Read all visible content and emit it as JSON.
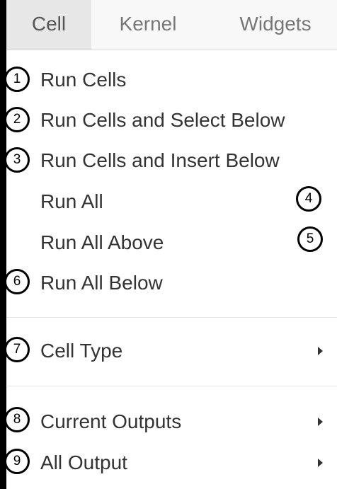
{
  "menubar": {
    "tabs": [
      {
        "label": "Cell",
        "active": true
      },
      {
        "label": "Kernel",
        "active": false
      },
      {
        "label": "Widgets",
        "active": false
      }
    ]
  },
  "cell_menu": {
    "items": [
      {
        "label": "Run Cells",
        "callout": "1"
      },
      {
        "label": "Run Cells and Select Below",
        "callout": "2"
      },
      {
        "label": "Run Cells and Insert Below",
        "callout": "3"
      },
      {
        "label": "Run All",
        "callout": "4"
      },
      {
        "label": "Run All Above",
        "callout": "5"
      },
      {
        "label": "Run All Below",
        "callout": "6"
      },
      {
        "label": "Cell Type",
        "callout": "7",
        "submenu": true
      },
      {
        "label": "Current Outputs",
        "callout": "8",
        "submenu": true
      },
      {
        "label": "All Output",
        "callout": "9",
        "submenu": true
      }
    ]
  },
  "icons": {
    "submenu": "caret-right-icon"
  },
  "colors": {
    "menubar_bg": "#f8f8f8",
    "active_tab_bg": "#e7e7e7",
    "tab_text": "#777777",
    "item_text": "#333333",
    "callout_border": "#000000"
  }
}
